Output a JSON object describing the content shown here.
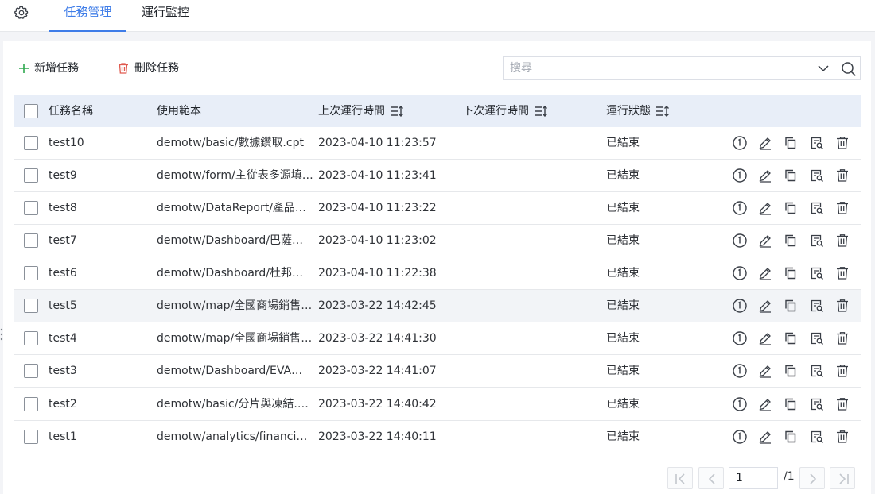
{
  "tabs": [
    {
      "label": "任務管理",
      "active": true
    },
    {
      "label": "運行監控",
      "active": false
    }
  ],
  "toolbar": {
    "add_label": "新增任務",
    "delete_label": "刪除任務",
    "search_placeholder": "搜尋"
  },
  "table": {
    "columns": [
      "任務名稱",
      "使用範本",
      "上次運行時間",
      "下次運行時間",
      "運行狀態"
    ],
    "rows": [
      {
        "name": "test10",
        "template": "demotw/basic/數據鑽取.cpt",
        "last_run": "2023-04-10 11:23:57",
        "next_run": "",
        "status": "已結束"
      },
      {
        "name": "test9",
        "template": "demotw/form/主從表多源填報.frm",
        "last_run": "2023-04-10 11:23:41",
        "next_run": "",
        "status": "已結束"
      },
      {
        "name": "test8",
        "template": "demotw/DataReport/產品月報.cpt",
        "last_run": "2023-04-10 11:23:22",
        "next_run": "",
        "status": "已結束"
      },
      {
        "name": "test7",
        "template": "demotw/Dashboard/巴薩利亞分析.frm",
        "last_run": "2023-04-10 11:23:02",
        "next_run": "",
        "status": "已結束"
      },
      {
        "name": "test6",
        "template": "demotw/Dashboard/杜邦分析.frm",
        "last_run": "2023-04-10 11:22:38",
        "next_run": "",
        "status": "已結束"
      },
      {
        "name": "test5",
        "template": "demotw/map/全國商場銷售分析.frm",
        "last_run": "2023-03-22 14:42:45",
        "next_run": "",
        "status": "已結束"
      },
      {
        "name": "test4",
        "template": "demotw/map/全國商場銷售地圖.frm",
        "last_run": "2023-03-22 14:41:30",
        "next_run": "",
        "status": "已結束"
      },
      {
        "name": "test3",
        "template": "demotw/Dashboard/EVA經濟附加值.frm",
        "last_run": "2023-03-22 14:41:07",
        "next_run": "",
        "status": "已結束"
      },
      {
        "name": "test2",
        "template": "demotw/basic/分片與凍結.cpt",
        "last_run": "2023-03-22 14:40:42",
        "next_run": "",
        "status": "已結束"
      },
      {
        "name": "test1",
        "template": "demotw/analytics/financial/利潤分析.cpt",
        "last_run": "2023-03-22 14:40:11",
        "next_run": "",
        "status": "已結束"
      }
    ],
    "row_icons": [
      "run-once-icon",
      "edit-icon",
      "copy-icon",
      "view-log-icon",
      "delete-icon"
    ]
  },
  "pagination": {
    "current_page": "1",
    "total_label": "/1"
  },
  "colors": {
    "accent": "#3f7de8",
    "add_icon": "#2fa84f",
    "delete_icon": "#e05a4f",
    "header_bg": "#e8eef8"
  }
}
